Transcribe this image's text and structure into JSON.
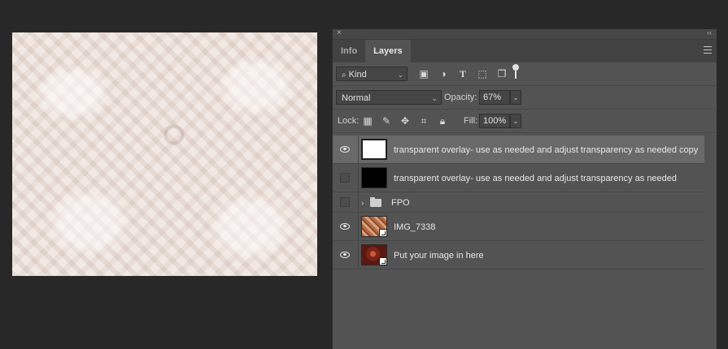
{
  "panel": {
    "close_glyph": "×",
    "collapse_glyph": "‹‹",
    "tabs": [
      {
        "label": "Info",
        "active": false
      },
      {
        "label": "Layers",
        "active": true
      }
    ]
  },
  "filter": {
    "kind_label": "Kind",
    "icons": [
      "image-filter-icon",
      "adjustment-filter-icon",
      "type-filter-icon",
      "shape-filter-icon",
      "smart-object-filter-icon"
    ]
  },
  "blend": {
    "mode": "Normal",
    "opacity_label": "Opacity:",
    "opacity_value": "67%"
  },
  "lock": {
    "label": "Lock:",
    "fill_label": "Fill:",
    "fill_value": "100%"
  },
  "layers": [
    {
      "name": "transparent overlay- use as needed and adjust transparency as needed copy",
      "visible": true,
      "thumb": "white",
      "selected": true
    },
    {
      "name": "transparent overlay- use as needed and adjust transparency as needed",
      "visible": false,
      "thumb": "black",
      "selected": false
    },
    {
      "name": "FPO",
      "visible": false,
      "group": true,
      "selected": false
    },
    {
      "name": "IMG_7338",
      "visible": true,
      "thumb": "img1",
      "smart": true,
      "selected": false
    },
    {
      "name": "Put your image in here",
      "visible": true,
      "thumb": "img2",
      "smart": true,
      "selected": false
    }
  ],
  "colors": {
    "background": "#282828",
    "panel": "#535353",
    "selected_row": "#696969"
  }
}
